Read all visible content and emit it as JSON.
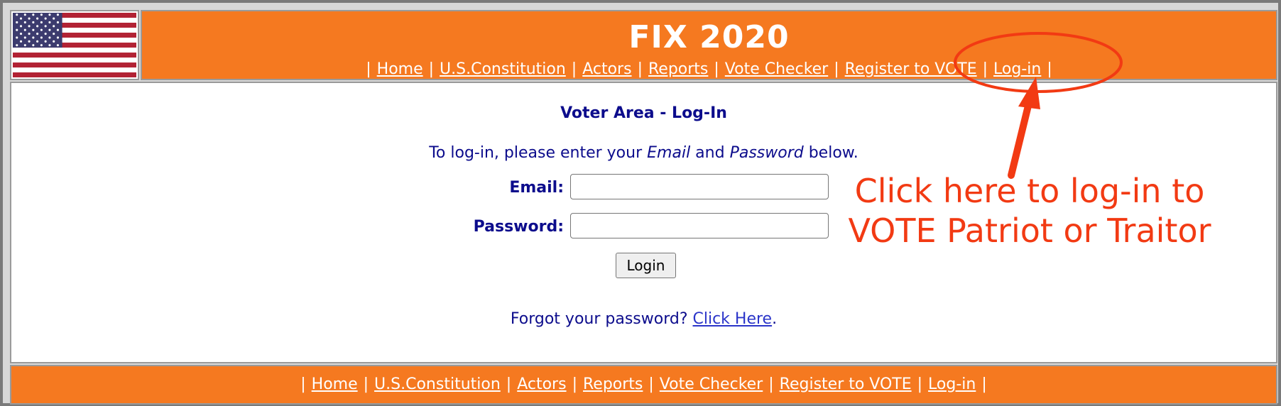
{
  "header": {
    "title": "FIX 2020",
    "flag_icon": "us-flag-icon"
  },
  "nav": {
    "separator": "|",
    "items": [
      "Home",
      "U.S.Constitution",
      "Actors",
      "Reports",
      "Vote Checker",
      "Register to VOTE",
      "Log-in"
    ]
  },
  "login": {
    "title": "Voter Area - Log-In",
    "intro_before": "To log-in, please enter your ",
    "intro_email": "Email",
    "intro_and": " and ",
    "intro_password": "Password",
    "intro_after": " below.",
    "email_label": "Email:",
    "password_label": "Password:",
    "email_value": "",
    "password_value": "",
    "button_label": "Login",
    "forgot_text": "Forgot your password? ",
    "forgot_link": "Click Here",
    "forgot_end": "."
  },
  "annotation": {
    "line1": "Click here to log-in to",
    "line2": "VOTE Patriot or Traitor",
    "color": "#f23a13"
  },
  "colors": {
    "header_bg": "#f57920",
    "text_navy": "#0c0c8c",
    "link_blue": "#2b35c9"
  }
}
